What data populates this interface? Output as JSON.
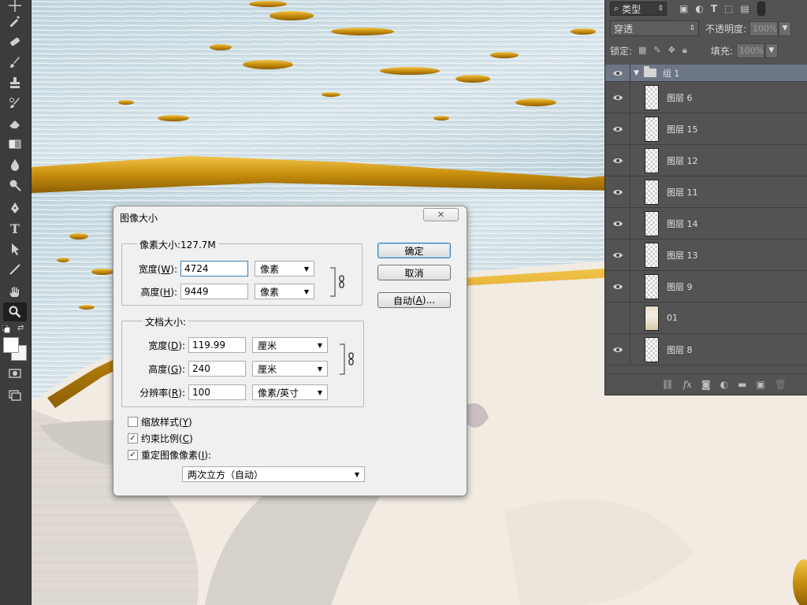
{
  "toolbar": {
    "tools": [
      "move-icon",
      "eyedropper-icon",
      "healing-brush-icon",
      "brush-icon",
      "clone-stamp-icon",
      "history-brush-icon",
      "eraser-icon",
      "gradient-icon",
      "blur-icon",
      "dodge-icon",
      "pen-icon",
      "text-icon",
      "path-select-icon",
      "line-icon",
      "hand-icon",
      "zoom-icon"
    ],
    "active_tool": "zoom-icon",
    "type_tool_glyph": "T"
  },
  "layers_panel": {
    "filter": {
      "label": "类型"
    },
    "blend_mode": "穿透",
    "opacity_label": "不透明度:",
    "opacity_value": "100%",
    "lock_label": "锁定:",
    "fill_label": "填充:",
    "fill_value": "100%",
    "group": {
      "name": "组 1"
    },
    "layers": [
      {
        "name": "图层 6",
        "thumb": "transparent"
      },
      {
        "name": "图层 15",
        "thumb": "transparent"
      },
      {
        "name": "图层 12",
        "thumb": "transparent"
      },
      {
        "name": "图层 11",
        "thumb": "transparent"
      },
      {
        "name": "图层 14",
        "thumb": "transparent"
      },
      {
        "name": "图层 13",
        "thumb": "transparent"
      },
      {
        "name": "图层 9",
        "thumb": "transparent"
      },
      {
        "name": "01",
        "thumb": "art",
        "hidden": true
      },
      {
        "name": "图层 8",
        "thumb": "transparent"
      }
    ],
    "footer_icons": [
      "link-icon",
      "fx-icon",
      "mask-icon",
      "adjustment-icon",
      "folder-icon",
      "new-layer-icon",
      "trash-icon"
    ],
    "fx_glyph": "fx"
  },
  "dialog": {
    "title": "图像大小",
    "close_glyph": "✕",
    "pixel_dimensions": {
      "legend": "像素大小:127.7M",
      "width": {
        "label": "宽度",
        "key": "W",
        "value": "4724",
        "unit": "像素"
      },
      "height": {
        "label": "高度",
        "key": "H",
        "value": "9449",
        "unit": "像素"
      }
    },
    "document_size": {
      "legend": "文档大小:",
      "width": {
        "label": "宽度",
        "key": "D",
        "value": "119.99",
        "unit": "厘米"
      },
      "height": {
        "label": "高度",
        "key": "G",
        "value": "240",
        "unit": "厘米"
      },
      "resolution": {
        "label": "分辨率",
        "key": "R",
        "value": "100",
        "unit": "像素/英寸"
      }
    },
    "buttons": {
      "ok": "确定",
      "cancel": "取消",
      "auto": {
        "label": "自动",
        "key": "A",
        "suffix": "..."
      }
    },
    "options": {
      "scale_styles": {
        "label": "缩放样式",
        "key": "Y",
        "checked": false
      },
      "constrain": {
        "label": "约束比例",
        "key": "C",
        "checked": true
      },
      "resample": {
        "label": "重定图像像素",
        "key": "I",
        "checked": true,
        "colon": ":"
      }
    },
    "resample_method": "两次立方（自动）"
  },
  "colors": {
    "ui_dark": "#3c3c3c",
    "panel": "#535353",
    "gold": "#d49a0b",
    "brush_blue": "#c7d9e0"
  }
}
